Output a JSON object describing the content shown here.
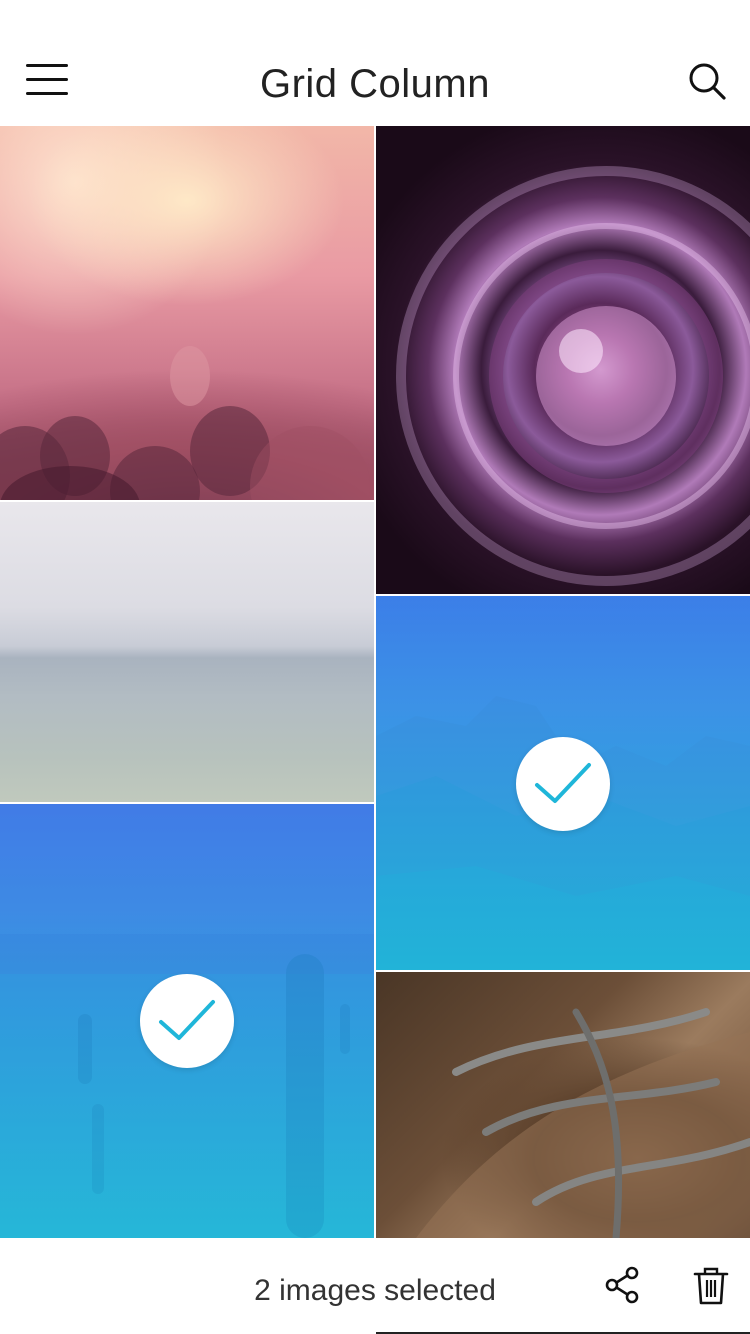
{
  "header": {
    "title": "Grid Column",
    "menu_icon": "hamburger-menu-icon",
    "search_icon": "search-icon"
  },
  "grid": {
    "tiles": [
      {
        "subject": "concert",
        "selected": false
      },
      {
        "subject": "camera-lens",
        "selected": false
      },
      {
        "subject": "sea-horizon",
        "selected": false
      },
      {
        "subject": "mountains",
        "selected": true
      },
      {
        "subject": "desert-cactus",
        "selected": true
      },
      {
        "subject": "leather-shoe",
        "selected": false
      }
    ],
    "accent_color": "#1fb6d9",
    "overlay_colors": [
      "#3a78ec",
      "#1ebedc"
    ]
  },
  "footer": {
    "selection_text": "2 images selected",
    "share_icon": "share-icon",
    "delete_icon": "trash-icon"
  }
}
